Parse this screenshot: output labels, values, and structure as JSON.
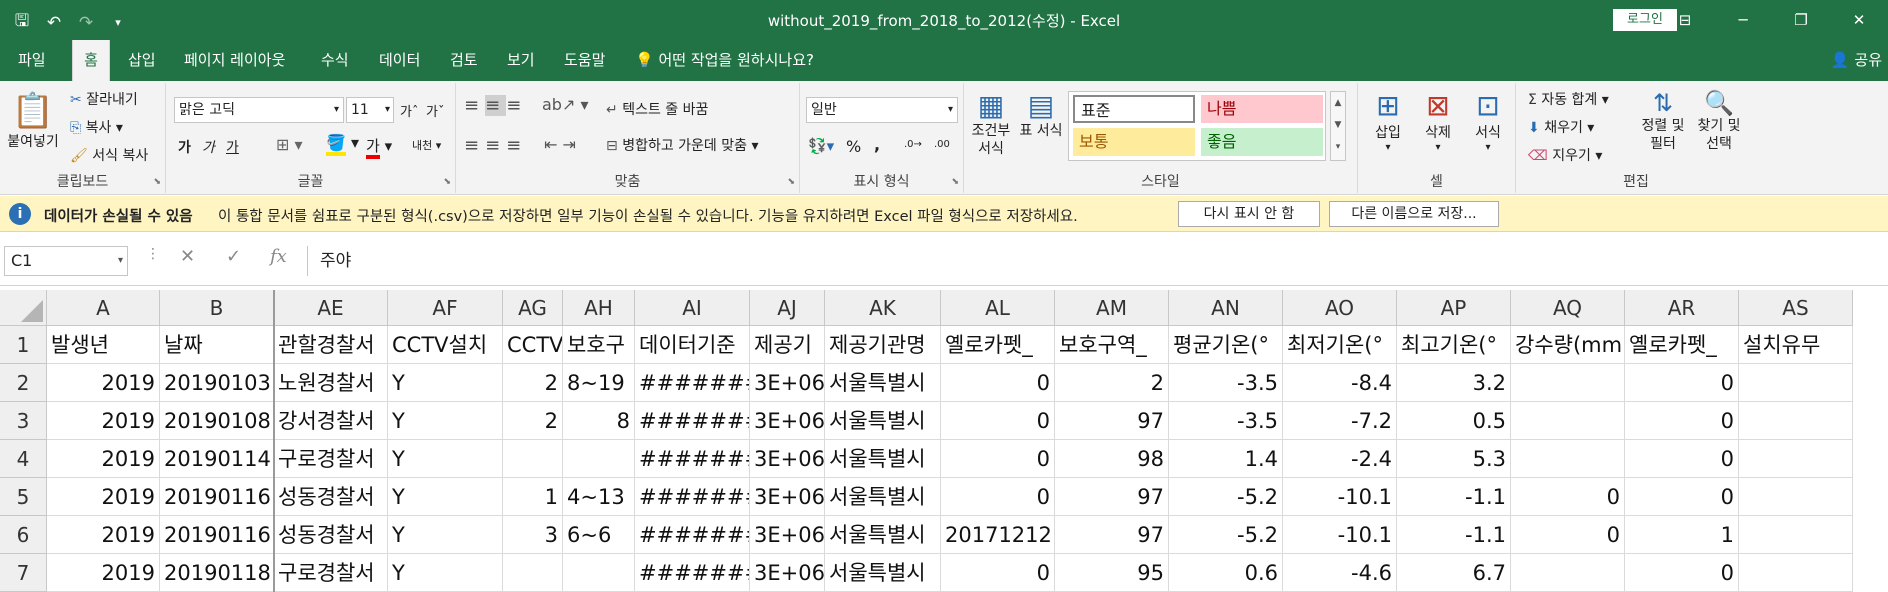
{
  "window": {
    "title": "without_2019_from_2018_to_2012(수정)  -  Excel",
    "login_label": "로그인",
    "qat_icons": [
      "save-icon",
      "undo-icon",
      "redo-icon",
      "customize-icon"
    ],
    "controls": [
      "ribbon-display-icon",
      "minimize-icon",
      "maximize-icon",
      "close-icon"
    ]
  },
  "tabs": [
    "파일",
    "홈",
    "삽입",
    "페이지 레이아웃",
    "수식",
    "데이터",
    "검토",
    "보기",
    "도움말"
  ],
  "tell_me": "어떤 작업을 원하시나요?",
  "share_label": "공유",
  "ribbon": {
    "clipboard": {
      "label": "클립보드",
      "paste": "붙여넣기",
      "cut": "잘라내기",
      "copy": "복사",
      "format_painter": "서식 복사"
    },
    "font": {
      "label": "글꼴",
      "name": "맑은 고딕",
      "size": "11",
      "bold": "가",
      "italic": "가",
      "underline": "가",
      "font_color": "가"
    },
    "alignment": {
      "label": "맞춤",
      "wrap": "텍스트 줄 바꿈",
      "merge": "병합하고 가운데 맞춤"
    },
    "number": {
      "label": "표시 형식",
      "format": "일반",
      "percent": "%",
      "comma": ","
    },
    "styles": {
      "label": "스타일",
      "conditional": "조건부 서식",
      "table": "표 서식",
      "standard": "표준",
      "bad": "나쁨",
      "normal": "보통",
      "good": "좋음"
    },
    "cells": {
      "label": "셀",
      "insert": "삽입",
      "delete": "삭제",
      "format": "서식"
    },
    "editing": {
      "label": "편집",
      "autosum": "자동 합계",
      "fill": "채우기",
      "clear": "지우기",
      "sort": "정렬 및 필터",
      "find": "찾기 및 선택"
    }
  },
  "infobar": {
    "title": "데이터가 손실될 수 있음",
    "message": "이 통합 문서를 쉼표로 구분된 형식(.csv)으로 저장하면 일부 기능이 손실될 수 있습니다. 기능을 유지하려면 Excel 파일 형식으로 저장하세요.",
    "btn_dismiss": "다시 표시 안 함",
    "btn_saveas": "다른 이름으로 저장..."
  },
  "formula_bar": {
    "name_box": "C1",
    "content": "주야"
  },
  "sheet": {
    "columns": [
      "A",
      "B",
      "AE",
      "AF",
      "AG",
      "AH",
      "AI",
      "AJ",
      "AK",
      "AL",
      "AM",
      "AN",
      "AO",
      "AP",
      "AQ",
      "AR",
      "AS"
    ],
    "rows": [
      "1",
      "2",
      "3",
      "4",
      "5",
      "6",
      "7"
    ],
    "cells": [
      [
        "발생년",
        "날짜",
        "관할경찰서",
        "CCTV설치",
        "CCTV",
        "보호구",
        "데이터기준",
        "제공기",
        "제공기관명",
        "옐로카펫_",
        "보호구역_",
        "평균기온(°",
        "최저기온(°",
        "최고기온(°",
        "강수량(mm",
        "옐로카펫_",
        "설치유무"
      ],
      [
        "2019",
        "20190103",
        "노원경찰서",
        "Y",
        "2",
        "8~19",
        "#######",
        "3E+06",
        "서울특별시",
        "0",
        "2",
        "-3.5",
        "-8.4",
        "3.2",
        "",
        "0",
        ""
      ],
      [
        "2019",
        "20190108",
        "강서경찰서",
        "Y",
        "2",
        "8",
        "#######",
        "3E+06",
        "서울특별시",
        "0",
        "97",
        "-3.5",
        "-7.2",
        "0.5",
        "",
        "0",
        ""
      ],
      [
        "2019",
        "20190114",
        "구로경찰서",
        "Y",
        "",
        "",
        "#######",
        "3E+06",
        "서울특별시",
        "0",
        "98",
        "1.4",
        "-2.4",
        "5.3",
        "",
        "0",
        ""
      ],
      [
        "2019",
        "20190116",
        "성동경찰서",
        "Y",
        "1",
        "4~13",
        "#######",
        "3E+06",
        "서울특별시",
        "0",
        "97",
        "-5.2",
        "-10.1",
        "-1.1",
        "0",
        "0",
        ""
      ],
      [
        "2019",
        "20190116",
        "성동경찰서",
        "Y",
        "3",
        "6~6",
        "#######",
        "3E+06",
        "서울특별시",
        "20171212",
        "97",
        "-5.2",
        "-10.1",
        "-1.1",
        "0",
        "1",
        ""
      ],
      [
        "2019",
        "20190118",
        "구로경찰서",
        "Y",
        "",
        "",
        "#######",
        "3E+06",
        "서울특별시",
        "0",
        "95",
        "0.6",
        "-4.6",
        "6.7",
        "",
        "0",
        ""
      ]
    ]
  }
}
